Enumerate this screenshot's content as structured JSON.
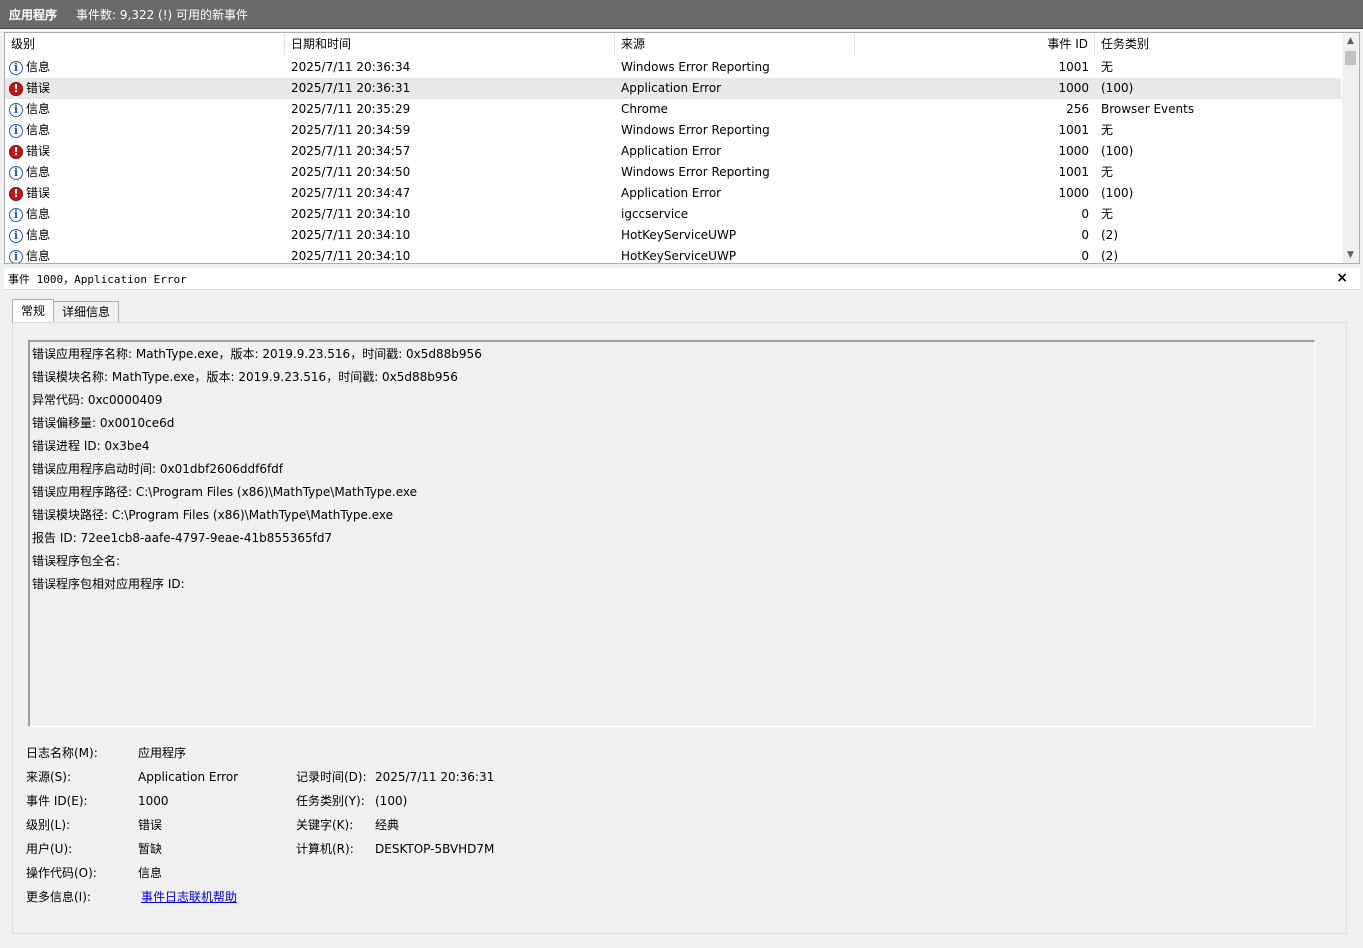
{
  "titlebar": {
    "name": "应用程序",
    "count": "事件数: 9,322 (!) 可用的新事件"
  },
  "list": {
    "columns": [
      "级别",
      "日期和时间",
      "来源",
      "事件 ID",
      "任务类别"
    ],
    "rows": [
      {
        "icon": "info-icon",
        "level": "信息",
        "datetime": "2025/7/11 20:36:34",
        "source": "Windows Error Reporting",
        "event_id": "1001",
        "task": "无"
      },
      {
        "icon": "error-icon",
        "level": "错误",
        "datetime": "2025/7/11 20:36:31",
        "source": "Application Error",
        "event_id": "1000",
        "task": "(100)",
        "selected": true
      },
      {
        "icon": "info-icon",
        "level": "信息",
        "datetime": "2025/7/11 20:35:29",
        "source": "Chrome",
        "event_id": "256",
        "task": "Browser Events"
      },
      {
        "icon": "info-icon",
        "level": "信息",
        "datetime": "2025/7/11 20:34:59",
        "source": "Windows Error Reporting",
        "event_id": "1001",
        "task": "无"
      },
      {
        "icon": "error-icon",
        "level": "错误",
        "datetime": "2025/7/11 20:34:57",
        "source": "Application Error",
        "event_id": "1000",
        "task": "(100)"
      },
      {
        "icon": "info-icon",
        "level": "信息",
        "datetime": "2025/7/11 20:34:50",
        "source": "Windows Error Reporting",
        "event_id": "1001",
        "task": "无"
      },
      {
        "icon": "error-icon",
        "level": "错误",
        "datetime": "2025/7/11 20:34:47",
        "source": "Application Error",
        "event_id": "1000",
        "task": "(100)"
      },
      {
        "icon": "info-icon",
        "level": "信息",
        "datetime": "2025/7/11 20:34:10",
        "source": "igccservice",
        "event_id": "0",
        "task": "无"
      },
      {
        "icon": "info-icon",
        "level": "信息",
        "datetime": "2025/7/11 20:34:10",
        "source": "HotKeyServiceUWP",
        "event_id": "0",
        "task": "(2)"
      },
      {
        "icon": "info-icon",
        "level": "信息",
        "datetime": "2025/7/11 20:34:10",
        "source": "HotKeyServiceUWP",
        "event_id": "0",
        "task": "(2)"
      }
    ]
  },
  "detail": {
    "title": "事件 1000，Application Error",
    "close": "×",
    "tabs": [
      "常规",
      "详细信息"
    ],
    "message_lines": [
      "错误应用程序名称: MathType.exe，版本: 2019.9.23.516，时间戳: 0x5d88b956",
      "错误模块名称: MathType.exe，版本: 2019.9.23.516，时间戳: 0x5d88b956",
      "异常代码: 0xc0000409",
      "错误偏移量: 0x0010ce6d",
      "错误进程 ID: 0x3be4",
      "错误应用程序启动时间: 0x01dbf2606ddf6fdf",
      "错误应用程序路径: C:\\Program Files (x86)\\MathType\\MathType.exe",
      "错误模块路径: C:\\Program Files (x86)\\MathType\\MathType.exe",
      "报告 ID: 72ee1cb8-aafe-4797-9eae-41b855365fd7",
      "错误程序包全名:",
      "错误程序包相对应用程序 ID:"
    ],
    "props": {
      "log_name_label": "日志名称(M):",
      "log_name": "应用程序",
      "source_label": "来源(S):",
      "source": "Application Error",
      "logged_label": "记录时间(D):",
      "logged": "2025/7/11 20:36:31",
      "event_id_label": "事件 ID(E):",
      "event_id": "1000",
      "task_label": "任务类别(Y):",
      "task": "(100)",
      "level_label": "级别(L):",
      "level": "错误",
      "keywords_label": "关键字(K):",
      "keywords": "经典",
      "user_label": "用户(U):",
      "user": "暂缺",
      "computer_label": "计算机(R):",
      "computer": "DESKTOP-5BVHD7M",
      "opcode_label": "操作代码(O):",
      "opcode": "信息",
      "more_info_label": "更多信息(I):",
      "more_info_link": "事件日志联机帮助"
    }
  }
}
